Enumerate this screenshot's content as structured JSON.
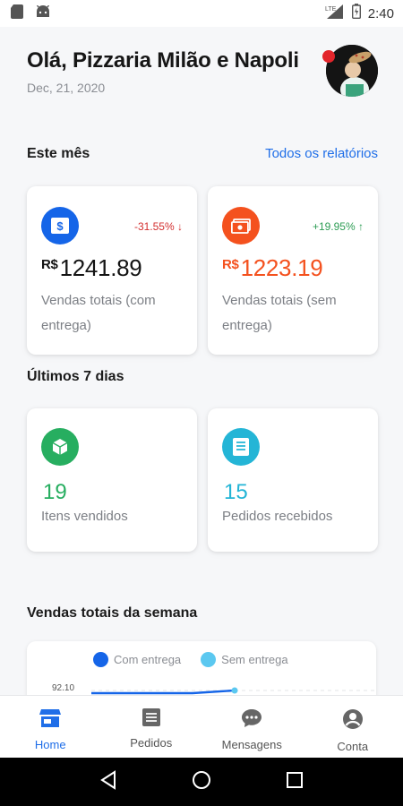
{
  "status_bar": {
    "time": "2:40",
    "network": "LTE"
  },
  "header": {
    "greeting": "Olá, Pizzaria Milão e Napoli",
    "date": "Dec, 21, 2020"
  },
  "this_month": {
    "title": "Este mês",
    "link": "Todos os relatórios",
    "cards": [
      {
        "currency": "R$",
        "value": "1241.89",
        "change": "-31.55%",
        "change_direction": "down",
        "label": "Vendas totais (com entrega)",
        "icon": "dollar-icon",
        "icon_color": "#1565e8",
        "value_color": "#141414",
        "change_color": "#d32f2f"
      },
      {
        "currency": "R$",
        "value": "1223.19",
        "change": "+19.95%",
        "change_direction": "up",
        "label": "Vendas totais (sem entrega)",
        "icon": "cash-icon",
        "icon_color": "#f4511e",
        "value_color": "#f4511e",
        "change_color": "#2e9d55"
      }
    ]
  },
  "last_7_days": {
    "title": "Últimos 7 dias",
    "cards": [
      {
        "value": "19",
        "label": "Itens vendidos",
        "icon": "box-icon",
        "icon_color": "#27ae60",
        "value_color": "#27ae60"
      },
      {
        "value": "15",
        "label": "Pedidos recebidos",
        "icon": "receipt-icon",
        "icon_color": "#24b5d6",
        "value_color": "#24b5d6"
      }
    ]
  },
  "weekly_chart": {
    "title": "Vendas totais da semana",
    "legend": [
      {
        "name": "Com entrega",
        "color": "#1565e8"
      },
      {
        "name": "Sem entrega",
        "color": "#5bc8f0"
      }
    ],
    "tick_label": "92.10"
  },
  "bottom_nav": {
    "items": [
      {
        "label": "Home",
        "icon": "store-icon",
        "active": true
      },
      {
        "label": "Pedidos",
        "icon": "list-icon",
        "active": false
      },
      {
        "label": "Mensagens",
        "icon": "chat-icon",
        "active": false
      },
      {
        "label": "Conta",
        "icon": "account-icon",
        "active": false
      }
    ]
  },
  "colors": {
    "accent": "#1f6ee8",
    "background": "#f6f7f9"
  }
}
